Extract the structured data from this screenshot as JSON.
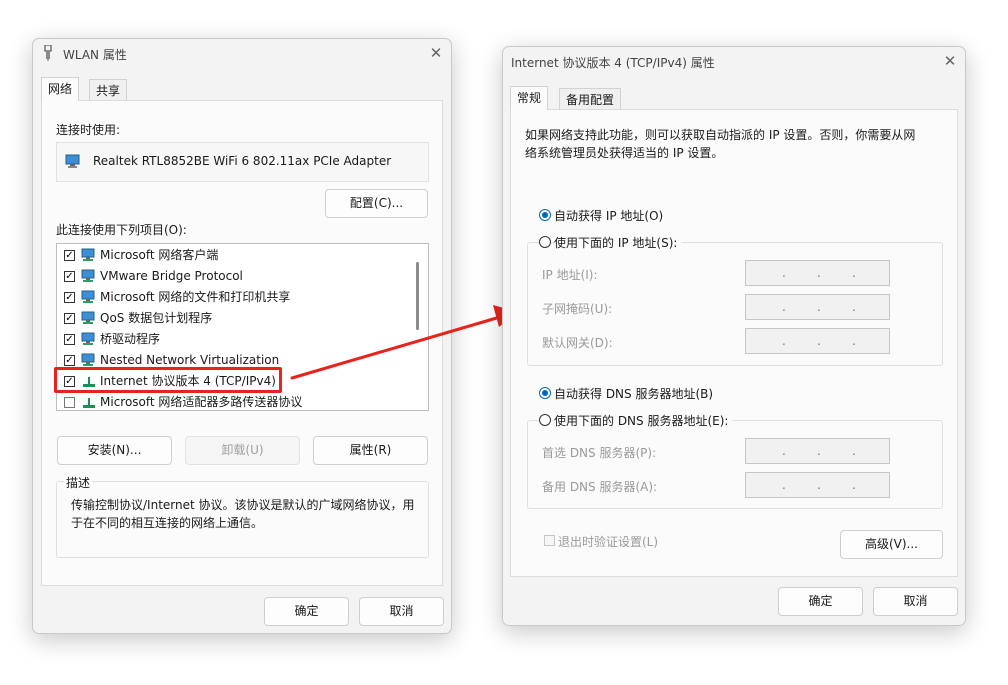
{
  "wlan": {
    "title": "WLAN 属性",
    "close": "✕",
    "tabs": [
      "网络",
      "共享"
    ],
    "connect_using_label": "连接时使用:",
    "adapter_name": "Realtek RTL8852BE WiFi 6 802.11ax PCIe Adapter",
    "configure_button": "配置(C)...",
    "items_label": "此连接使用下列项目(O):",
    "items": [
      {
        "label": "Microsoft 网络客户端",
        "checked": true
      },
      {
        "label": "VMware Bridge Protocol",
        "checked": true
      },
      {
        "label": "Microsoft 网络的文件和打印机共享",
        "checked": true
      },
      {
        "label": "QoS 数据包计划程序",
        "checked": true
      },
      {
        "label": "桥驱动程序",
        "checked": true
      },
      {
        "label": "Nested Network Virtualization",
        "checked": true
      },
      {
        "label": "Internet 协议版本 4 (TCP/IPv4)",
        "checked": true
      },
      {
        "label": "Microsoft 网络适配器多路传送器协议",
        "checked": false
      }
    ],
    "check_mark": "✓",
    "install_button": "安装(N)...",
    "uninstall_button": "卸载(U)",
    "properties_button": "属性(R)",
    "description_title": "描述",
    "description_text": "传输控制协议/Internet 协议。该协议是默认的广域网络协议，用于在不同的相互连接的网络上通信。",
    "ok_button": "确定",
    "cancel_button": "取消",
    "highlight_color": "#e8231d"
  },
  "ipv4": {
    "title": "Internet 协议版本 4 (TCP/IPv4) 属性",
    "close": "✕",
    "tabs": [
      "常规",
      "备用配置"
    ],
    "intro_text": "如果网络支持此功能，则可以获取自动指派的 IP 设置。否则，你需要从网络系统管理员处获得适当的 IP 设置。",
    "auto_ip": "自动获得 IP 地址(O)",
    "manual_ip": "使用下面的 IP 地址(S):",
    "ip_fields": [
      {
        "label": "IP 地址(I):"
      },
      {
        "label": "子网掩码(U):"
      },
      {
        "label": "默认网关(D):"
      }
    ],
    "auto_dns": "自动获得 DNS 服务器地址(B)",
    "manual_dns": "使用下面的 DNS 服务器地址(E):",
    "dns_fields": [
      {
        "label": "首选 DNS 服务器(P):"
      },
      {
        "label": "备用 DNS 服务器(A):"
      }
    ],
    "ip_dot": ".",
    "validate_checkbox": "退出时验证设置(L)",
    "advanced_button": "高级(V)...",
    "ok_button": "确定",
    "cancel_button": "取消",
    "accent_color": "#0067c0"
  },
  "arrow_color": "#e8231d"
}
